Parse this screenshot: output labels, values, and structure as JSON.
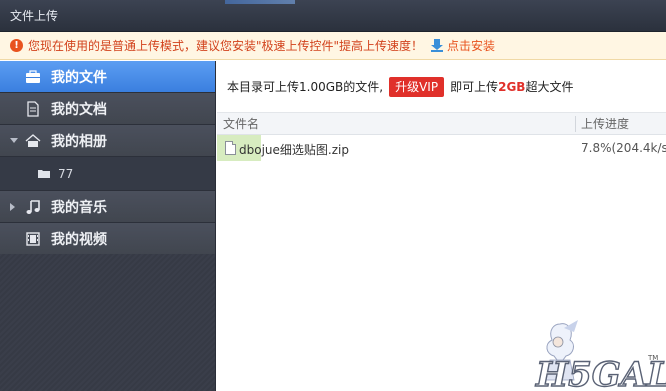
{
  "window": {
    "title": "文件上传"
  },
  "notice": {
    "message": "您现在使用的是普通上传模式，建议您安装\"极速上传控件\"提高上传速度！",
    "install_link": "点击安装"
  },
  "sidebar": {
    "items": [
      {
        "label": "我的文件",
        "icon": "briefcase-icon",
        "active": true
      },
      {
        "label": "我的文档",
        "icon": "document-icon"
      },
      {
        "label": "我的相册",
        "icon": "photo-album-icon",
        "expanded": true
      },
      {
        "label": "77",
        "icon": "folder-icon"
      },
      {
        "label": "我的音乐",
        "icon": "music-note-icon"
      },
      {
        "label": "我的视频",
        "icon": "film-icon"
      }
    ]
  },
  "main": {
    "quota_text": "本目录可上传1.00GB的文件,",
    "vip_button": "升级VIP",
    "vip_text_before": "即可上传",
    "vip_size": "2GB",
    "vip_text_after": "超大文件",
    "columns": {
      "name": "文件名",
      "progress": "上传进度"
    },
    "files": [
      {
        "name": "dbojue细选贴图.zip",
        "progress_text": "7.8%(204.4k/s",
        "progress": 0.078
      }
    ]
  },
  "watermark": {
    "text": "H5GAL",
    "tm": "TM"
  },
  "colors": {
    "accent": "#3a7fdf",
    "warning": "#e8531e",
    "vip": "#e0302a",
    "progress": "#d7ecc0"
  }
}
